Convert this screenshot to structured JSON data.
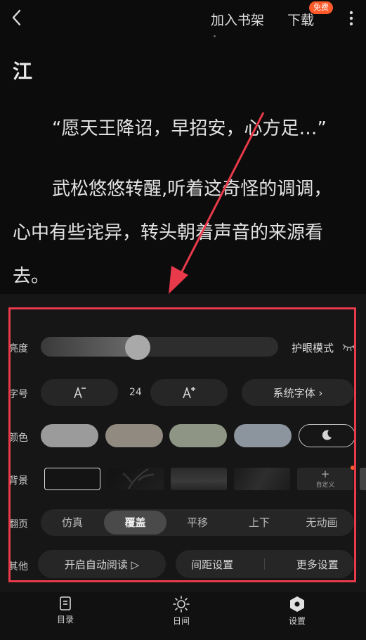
{
  "topbar": {
    "add_to_shelf": "加入书架",
    "download": "下载",
    "badge": "免费"
  },
  "content": {
    "chapter_title": "江",
    "paragraph1": "“愿天王降诏，早招安，心方足…”",
    "paragraph2_line1": "武松悠悠转醒,听着这奇怪的调调，",
    "paragraph2_line2": "心中有些诧异，转头朝着声音的来源看",
    "paragraph2_line3": "去。"
  },
  "settings": {
    "brightness": {
      "label": "亮度",
      "value_fraction": 0.4,
      "eye_mode_label": "护眼模式"
    },
    "font": {
      "label": "字号",
      "size_value": "24",
      "font_family_button": "系统字体 ›"
    },
    "color": {
      "label": "颜色",
      "swatches": [
        "#9b9b9b",
        "#908a80",
        "#8e9584",
        "#8c949e"
      ],
      "accent": "#e83a4a"
    },
    "background": {
      "label": "背景",
      "custom_label": "自定义"
    },
    "flip": {
      "label": "翻页",
      "options": [
        "仿真",
        "覆盖",
        "平移",
        "上下",
        "无动画"
      ],
      "selected": "覆盖"
    },
    "other": {
      "label": "其他",
      "auto_read": "开启自动阅读 ▷",
      "spacing": "间距设置",
      "more": "更多设置"
    }
  },
  "bottom_nav": {
    "items": [
      "目录",
      "日间",
      "设置"
    ]
  }
}
